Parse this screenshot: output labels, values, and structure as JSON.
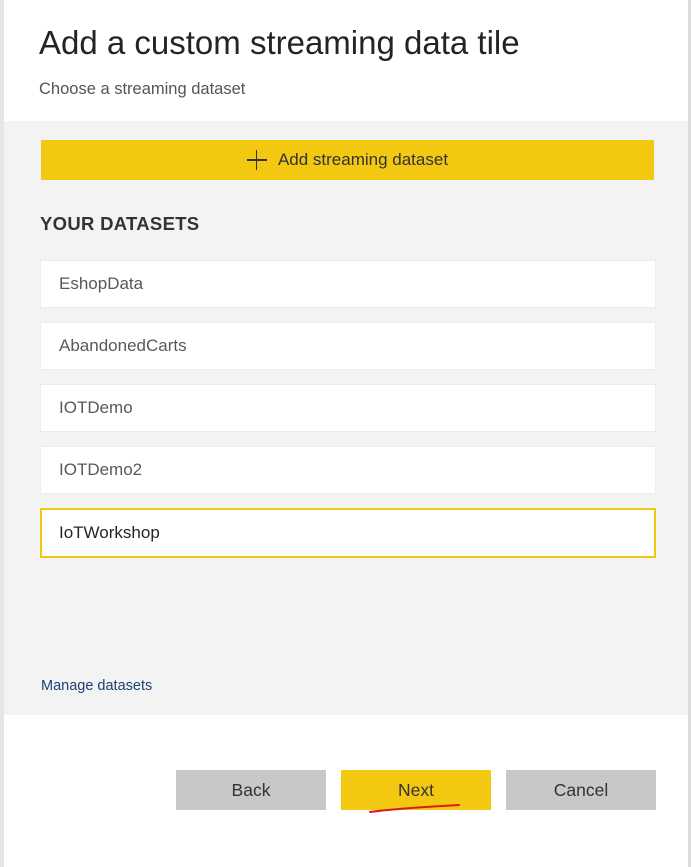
{
  "header": {
    "title": "Add a custom streaming data tile",
    "subtitle": "Choose a streaming dataset"
  },
  "add_dataset": {
    "icon": "plus-icon",
    "label": "Add streaming dataset"
  },
  "section_heading": "YOUR DATASETS",
  "datasets": [
    {
      "label": "EshopData",
      "selected": false
    },
    {
      "label": "AbandonedCarts",
      "selected": false
    },
    {
      "label": "IOTDemo",
      "selected": false
    },
    {
      "label": "IOTDemo2",
      "selected": false
    },
    {
      "label": "IoTWorkshop",
      "selected": true
    }
  ],
  "manage_link": "Manage datasets",
  "footer": {
    "back_label": "Back",
    "next_label": "Next",
    "cancel_label": "Cancel"
  },
  "colors": {
    "accent": "#f2c811",
    "secondary_button": "#c8c8c8",
    "link": "#1d3f75",
    "annotation": "#e0191f"
  }
}
